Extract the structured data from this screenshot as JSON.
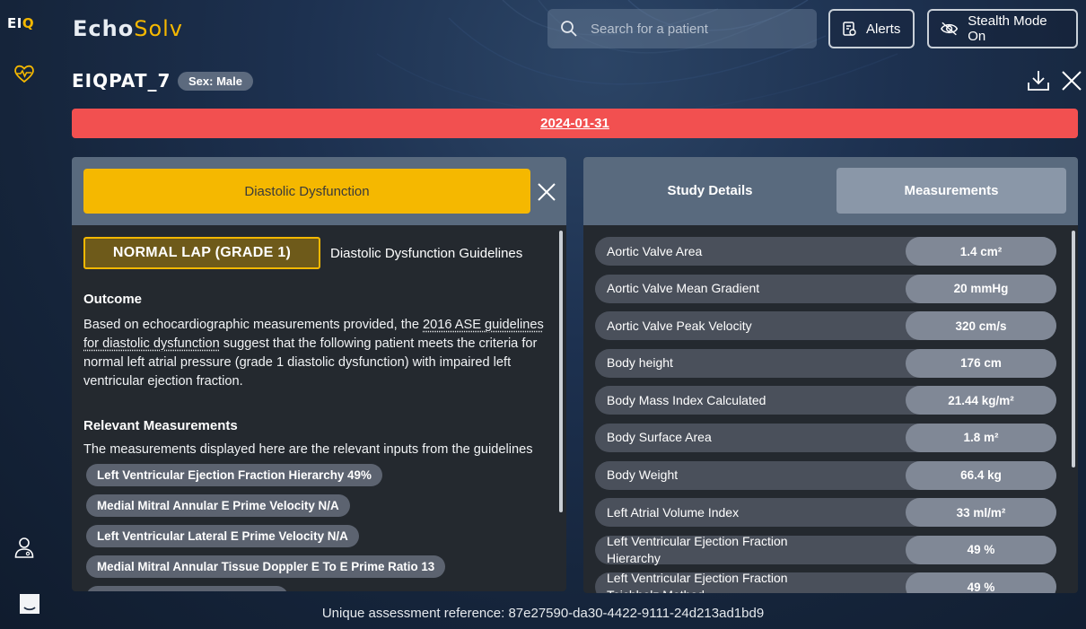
{
  "sidebar": {
    "logo_text_1": "EI",
    "logo_text_2": "Q",
    "icons": [
      "heart-pulse-icon",
      "doctor-icon",
      "chat-icon"
    ]
  },
  "header": {
    "brand_part_1": "Echo",
    "brand_part_2": "Solv",
    "search_placeholder": "Search for a patient",
    "alerts_label": "Alerts",
    "stealth_label": "Stealth Mode On"
  },
  "patient": {
    "id": "EIQPAT_7",
    "sex_badge": "Sex: Male",
    "study_date": "2024-01-31"
  },
  "assessment": {
    "title": "Diastolic Dysfunction",
    "grade": "NORMAL LAP (GRADE 1)",
    "guidelines_link": "Diastolic Dysfunction Guidelines",
    "outcome_heading": "Outcome",
    "outcome_prefix": "Based on echocardiographic measurements provided, the ",
    "outcome_link": "2016 ASE guidelines for diastolic dysfunction",
    "outcome_suffix": " suggest that the following patient meets the criteria for normal left atrial pressure (grade 1 diastolic dysfunction) with impaired left ventricular ejection fraction.",
    "relevant_heading": "Relevant Measurements",
    "relevant_intro": "The measurements displayed here are the relevant inputs from the guidelines",
    "chips": [
      "Left Ventricular Ejection Fraction Hierarchy 49%",
      "Medial Mitral Annular E Prime Velocity N/A",
      "Left Ventricular Lateral E Prime Velocity N/A",
      "Medial Mitral Annular Tissue Doppler E To E Prime Ratio 13",
      ""
    ]
  },
  "tabs": {
    "study_details": "Study Details",
    "measurements": "Measurements"
  },
  "measurements": [
    {
      "label": "Aortic Valve Area",
      "value": "1.4 cm²"
    },
    {
      "label": "Aortic Valve Mean Gradient",
      "value": "20 mmHg"
    },
    {
      "label": "Aortic Valve Peak Velocity",
      "value": "320 cm/s"
    },
    {
      "label": "Body height",
      "value": "176 cm"
    },
    {
      "label": "Body Mass Index Calculated",
      "value": "21.44 kg/m²"
    },
    {
      "label": "Body Surface Area",
      "value": "1.8 m²"
    },
    {
      "label": "Body Weight",
      "value": "66.4 kg"
    },
    {
      "label": "Left Atrial Volume Index",
      "value": "33 ml/m²"
    },
    {
      "label": "Left Ventricular Ejection Fraction Hierarchy",
      "value": "49 %"
    },
    {
      "label": "Left Ventricular Ejection Fraction Teichholz Method",
      "value": "49 %"
    }
  ],
  "footer": {
    "reference": "Unique assessment reference: 87e27590-da30-4422-9111-24d213ad1bd9"
  }
}
